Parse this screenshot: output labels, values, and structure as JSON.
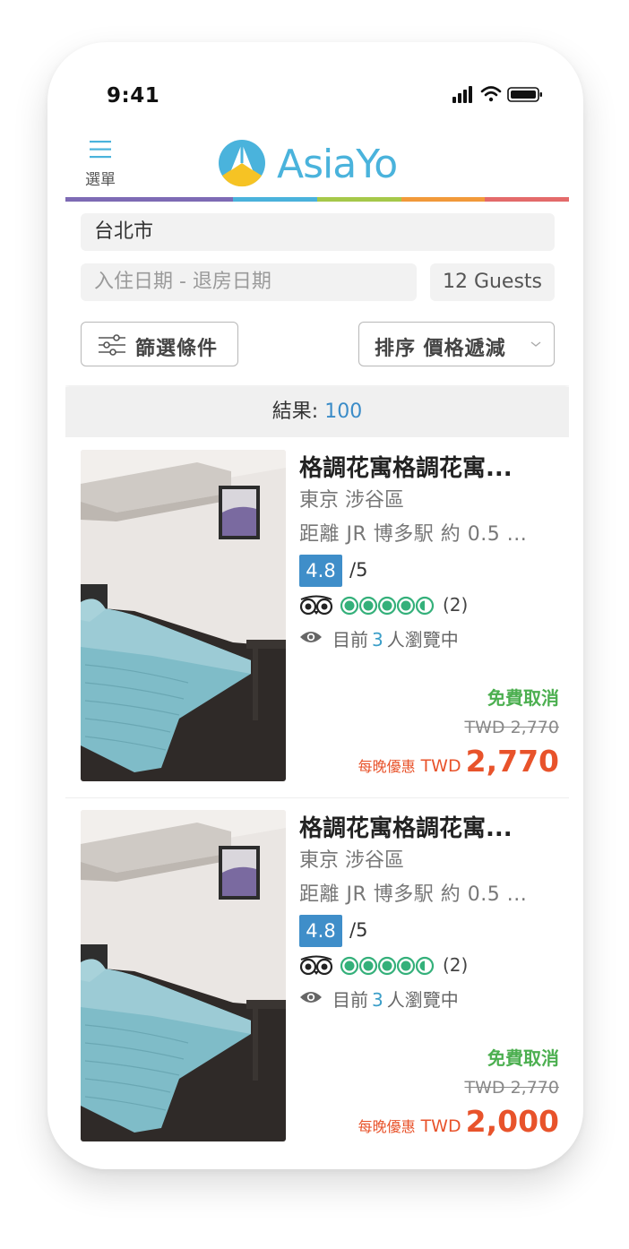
{
  "status_bar": {
    "time": "9:41"
  },
  "header": {
    "menu_label": "選單",
    "logo_text": "AsiaYo"
  },
  "brand_colors": [
    "#7e6bb5",
    "#4ab3dc",
    "#a6c94a",
    "#f3c533",
    "#f29a3a",
    "#e46b6b"
  ],
  "search": {
    "city": "台北市",
    "date_placeholder": "入住日期 - 退房日期",
    "guests": "12 Guests",
    "filter_label": "篩選條件",
    "sort_label": "排序 價格遞減"
  },
  "results": {
    "label": "結果:",
    "count": "100"
  },
  "listings": [
    {
      "title": "格調花寓格調花寓...",
      "location": "東京 涉谷區",
      "distance": "距離 JR 博多駅 約 0.5 ...",
      "rating": "4.8",
      "rating_max": "/5",
      "tripadvisor_bubbles": 4.5,
      "review_count": "(2)",
      "viewers_prefix": "目前",
      "viewers_count": "3",
      "viewers_suffix": "人瀏覽中",
      "free_cancel": "免費取消",
      "original_price": "TWD 2,770",
      "price_prefix": "每晚優惠",
      "price_currency": "TWD",
      "price_amount": "2,770"
    },
    {
      "title": "格調花寓格調花寓...",
      "location": "東京 涉谷區",
      "distance": "距離 JR 博多駅 約 0.5 ...",
      "rating": "4.8",
      "rating_max": "/5",
      "tripadvisor_bubbles": 4.5,
      "review_count": "(2)",
      "viewers_prefix": "目前",
      "viewers_count": "3",
      "viewers_suffix": "人瀏覽中",
      "free_cancel": "免費取消",
      "original_price": "TWD 2,770",
      "price_prefix": "每晚優惠",
      "price_currency": "TWD",
      "price_amount": "2,000"
    }
  ]
}
